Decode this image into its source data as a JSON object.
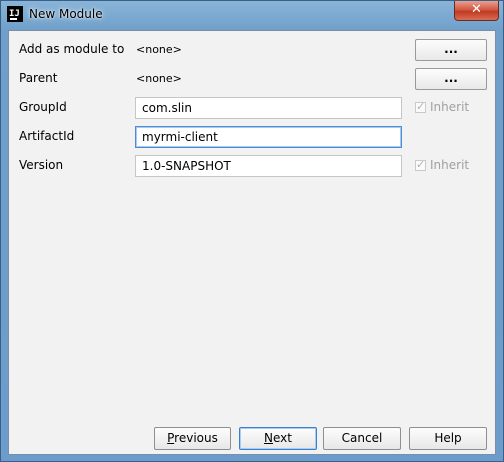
{
  "window": {
    "title": "New Module",
    "icon_text": "IJ",
    "close_glyph": "✕"
  },
  "form": {
    "add_as_module_to": {
      "label": "Add as module to",
      "value": "<none>",
      "button": "..."
    },
    "parent": {
      "label": "Parent",
      "value": "<none>",
      "button": "..."
    },
    "group_id": {
      "label": "GroupId",
      "value": "com.slin",
      "inherit_label": "Inherit",
      "inherit_checked": true
    },
    "artifact_id": {
      "label": "ArtifactId",
      "value": "myrmi-client"
    },
    "version": {
      "label": "Version",
      "value": "1.0-SNAPSHOT",
      "inherit_label": "Inherit",
      "inherit_checked": true
    }
  },
  "buttons": {
    "previous": {
      "mnemonic": "P",
      "rest": "revious"
    },
    "next": {
      "mnemonic": "N",
      "rest": "ext"
    },
    "cancel": "Cancel",
    "help": "Help"
  },
  "colors": {
    "focus_border": "#4d8bd3",
    "dialog_background": "#f2f2f2",
    "close_button": "#c03a22"
  }
}
